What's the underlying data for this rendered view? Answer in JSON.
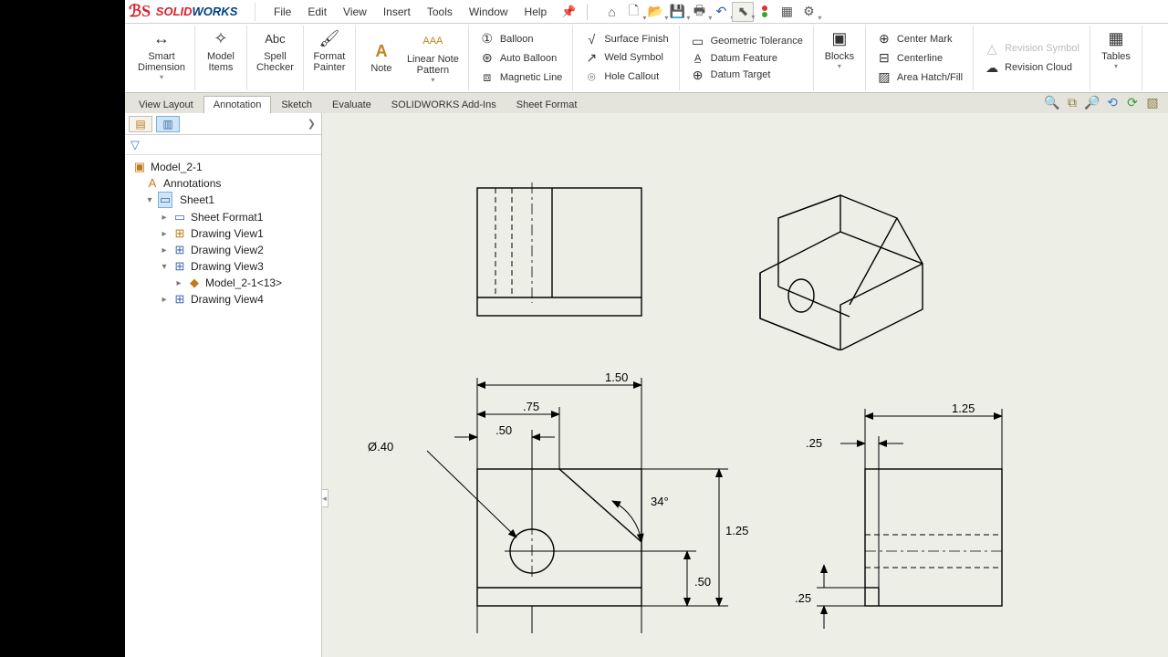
{
  "app_name": "SOLIDWORKS",
  "menu": [
    "File",
    "Edit",
    "View",
    "Insert",
    "Tools",
    "Window",
    "Help"
  ],
  "ribbon": {
    "smart_dimension": "Smart\nDimension",
    "model_items": "Model\nItems",
    "spell_checker": "Spell\nChecker",
    "format_painter": "Format\nPainter",
    "note": "Note",
    "linear_note_pattern": "Linear Note\nPattern",
    "balloon": "Balloon",
    "auto_balloon": "Auto Balloon",
    "magnetic_line": "Magnetic Line",
    "surface_finish": "Surface Finish",
    "weld_symbol": "Weld Symbol",
    "hole_callout": "Hole Callout",
    "geometric_tolerance": "Geometric Tolerance",
    "datum_feature": "Datum Feature",
    "datum_target": "Datum Target",
    "blocks": "Blocks",
    "center_mark": "Center Mark",
    "centerline": "Centerline",
    "area_hatch": "Area Hatch/Fill",
    "revision_symbol": "Revision Symbol",
    "revision_cloud": "Revision Cloud",
    "tables": "Tables"
  },
  "tabs": [
    "View Layout",
    "Annotation",
    "Sketch",
    "Evaluate",
    "SOLIDWORKS Add-Ins",
    "Sheet Format"
  ],
  "active_tab": "Annotation",
  "tree": {
    "root": "Model_2-1",
    "annotations": "Annotations",
    "sheet": "Sheet1",
    "sheet_format": "Sheet Format1",
    "views": [
      "Drawing View1",
      "Drawing View2",
      "Drawing View3",
      "Drawing View4"
    ],
    "subpart": "Model_2-1<13>"
  },
  "dimensions": {
    "width_150": "1.50",
    "w_75": ".75",
    "w_50": ".50",
    "dia_40": "Ø.40",
    "angle_34": "34°",
    "h_125": "1.25",
    "h_50_b": ".50",
    "side_125": "1.25",
    "side_25a": ".25",
    "side_25b": ".25"
  }
}
